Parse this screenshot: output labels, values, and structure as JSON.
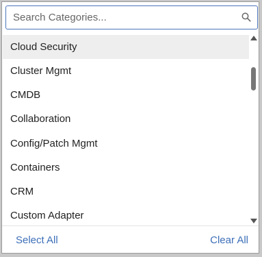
{
  "search": {
    "placeholder": "Search Categories...",
    "value": ""
  },
  "categories": [
    {
      "label": "Cloud Security",
      "highlighted": true
    },
    {
      "label": "Cluster Mgmt"
    },
    {
      "label": "CMDB"
    },
    {
      "label": "Collaboration"
    },
    {
      "label": "Config/Patch Mgmt"
    },
    {
      "label": "Containers"
    },
    {
      "label": "CRM"
    },
    {
      "label": "Custom Adapter"
    }
  ],
  "footer": {
    "select_all": "Select All",
    "clear_all": "Clear All"
  },
  "icons": {
    "search": "search-icon",
    "scroll_up": "scroll-up-arrow-icon",
    "scroll_down": "scroll-down-arrow-icon"
  },
  "colors": {
    "accent": "#3d6fb8",
    "border_focus": "#4a74b8",
    "highlight": "#eeeeee"
  }
}
